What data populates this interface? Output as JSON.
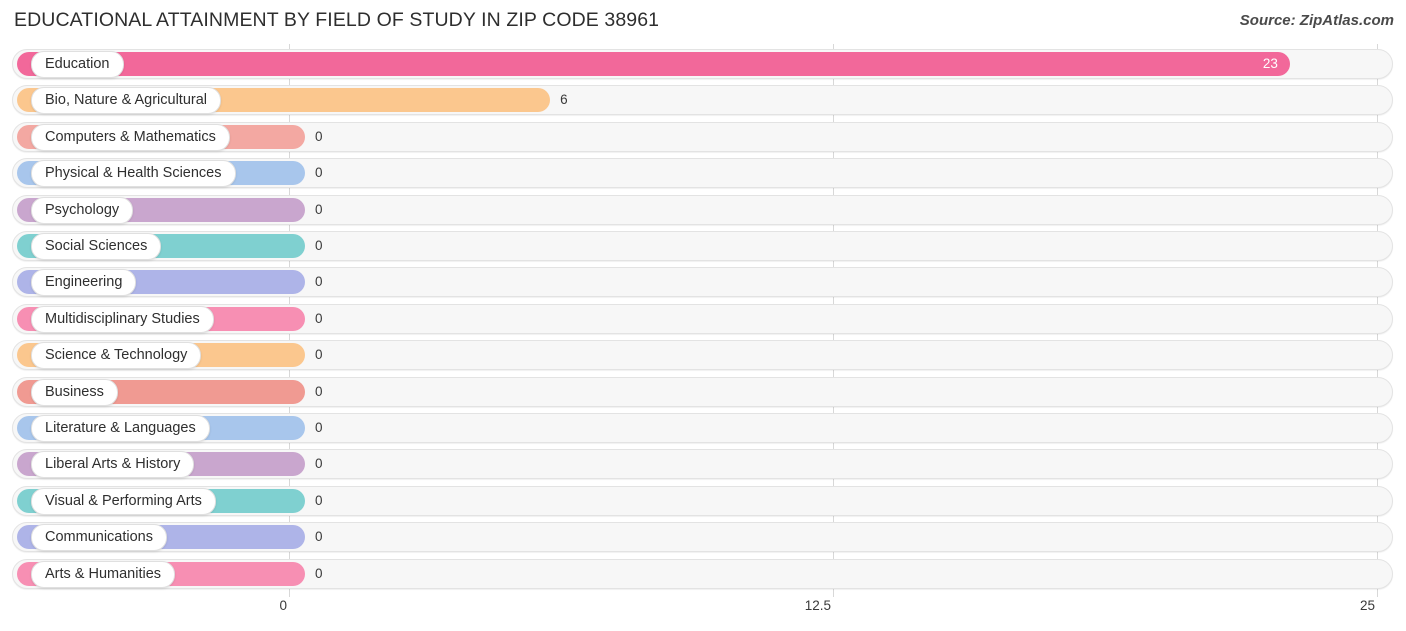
{
  "header": {
    "title": "EDUCATIONAL ATTAINMENT BY FIELD OF STUDY IN ZIP CODE 38961",
    "source": "Source: ZipAtlas.com"
  },
  "chart_data": {
    "type": "bar",
    "orientation": "horizontal",
    "title": "EDUCATIONAL ATTAINMENT BY FIELD OF STUDY IN ZIP CODE 38961",
    "xlabel": "",
    "ylabel": "",
    "xlim": [
      0,
      25
    ],
    "xticks": [
      0,
      12.5,
      25
    ],
    "xtick_labels": [
      "0",
      "12.5",
      "25"
    ],
    "grid": true,
    "legend": "none",
    "categories": [
      "Education",
      "Bio, Nature & Agricultural",
      "Computers & Mathematics",
      "Physical & Health Sciences",
      "Psychology",
      "Social Sciences",
      "Engineering",
      "Multidisciplinary Studies",
      "Science & Technology",
      "Business",
      "Literature & Languages",
      "Liberal Arts & History",
      "Visual & Performing Arts",
      "Communications",
      "Arts & Humanities"
    ],
    "values": [
      23,
      6,
      0,
      0,
      0,
      0,
      0,
      0,
      0,
      0,
      0,
      0,
      0,
      0,
      0
    ],
    "value_labels": [
      "23",
      "6",
      "0",
      "0",
      "0",
      "0",
      "0",
      "0",
      "0",
      "0",
      "0",
      "0",
      "0",
      "0",
      "0"
    ],
    "colors": [
      "#F2689A",
      "#FBC78E",
      "#F3A8A2",
      "#A8C6EC",
      "#C9A6CE",
      "#7FD0D0",
      "#AEB4E8",
      "#F78FB3",
      "#FBC78E",
      "#F09A92",
      "#A8C6EC",
      "#C9A6CE",
      "#7FD0D0",
      "#AEB4E8",
      "#F78FB3"
    ]
  },
  "colors": {
    "track_background": "#F7F7F7",
    "track_border": "#E3E3E3",
    "gridline": "#D8D8D8",
    "text": "#333333",
    "page_background": "#FFFFFF"
  }
}
